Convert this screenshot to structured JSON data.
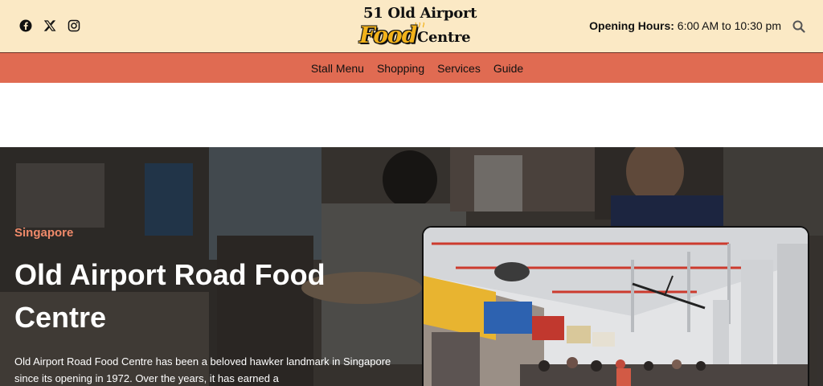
{
  "header": {
    "social": [
      {
        "icon": "facebook-icon"
      },
      {
        "icon": "x-twitter-icon"
      },
      {
        "icon": "instagram-icon"
      }
    ],
    "logo": {
      "line1": "51 Old Airport",
      "word_food": "Food",
      "word_centre": "Centre"
    },
    "hours_label": "Opening Hours:",
    "hours_value": " 6:00 AM to 10:30 pm",
    "search_icon": "search-icon"
  },
  "nav": {
    "items": [
      "Stall Menu",
      "Shopping",
      "Services",
      "Guide"
    ]
  },
  "hero": {
    "kicker": "Singapore",
    "title": "Old Airport Road Food Centre",
    "description": "Old Airport Road Food Centre has been a beloved hawker landmark in Singapore since its opening in 1972. Over the years, it has earned a"
  },
  "colors": {
    "topbar_bg": "#fbe9c5",
    "nav_bg": "#e06b52",
    "accent": "#f08a6a",
    "logo_gold": "#f2b21a"
  }
}
